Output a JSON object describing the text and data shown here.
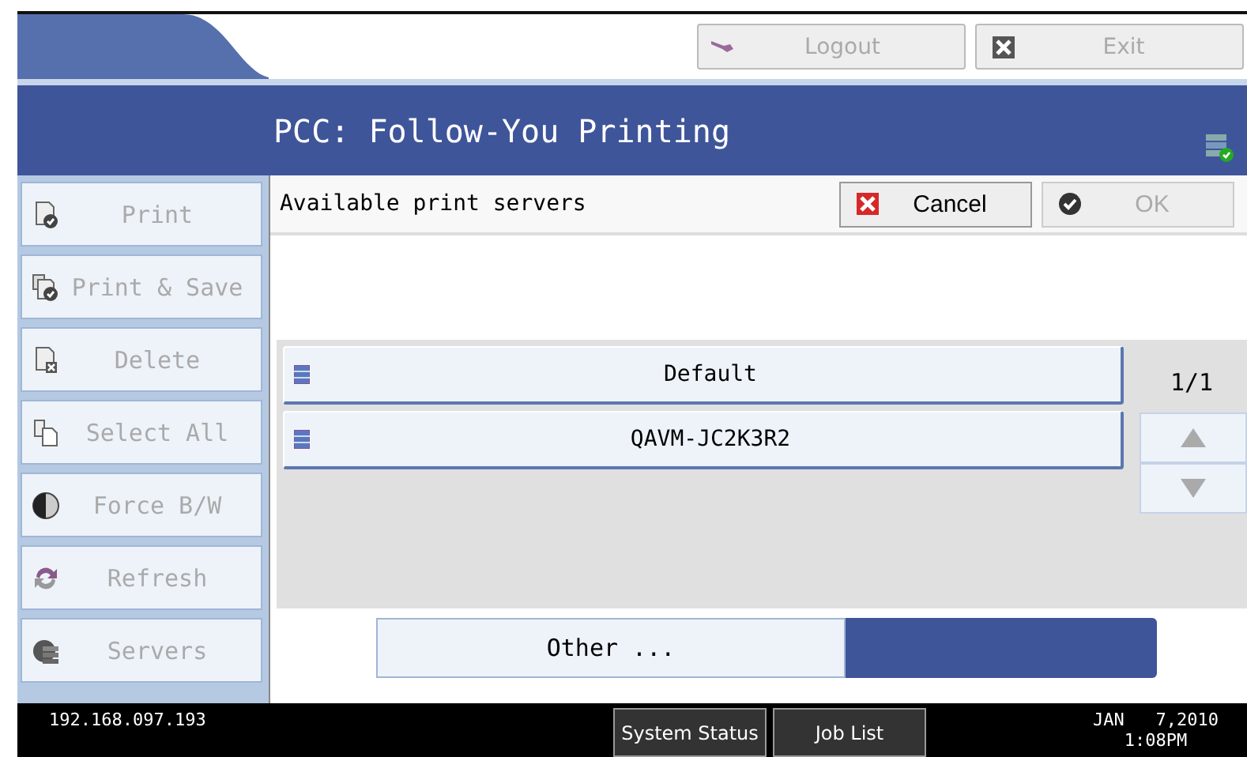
{
  "top_buttons": [
    {
      "kind": "logout",
      "label": "Logout",
      "disabled": true
    },
    {
      "kind": "exit",
      "label": "Exit",
      "disabled": true
    }
  ],
  "window": {
    "title": "PCC: Follow-You Printing"
  },
  "sidebar": {
    "items": [
      {
        "kind": "print",
        "label": "Print",
        "disabled": true
      },
      {
        "kind": "print-save",
        "label": "Print & Save",
        "disabled": true
      },
      {
        "kind": "delete",
        "label": "Delete",
        "disabled": true
      },
      {
        "kind": "select-all",
        "label": "Select All",
        "disabled": true
      },
      {
        "kind": "force-bw",
        "label": "Force B/W",
        "disabled": true
      },
      {
        "kind": "refresh",
        "label": "Refresh",
        "disabled": true
      },
      {
        "kind": "servers",
        "label": "Servers",
        "disabled": true
      }
    ]
  },
  "header": {
    "label": "Available print servers",
    "buttons": [
      {
        "kind": "cancel",
        "label": "Cancel",
        "disabled": false
      },
      {
        "kind": "ok",
        "label": "OK",
        "disabled": true
      }
    ]
  },
  "servers": {
    "items": [
      {
        "label": "Default",
        "selected": false
      },
      {
        "label": "QAVM-JC2K3R2",
        "selected": false
      }
    ],
    "page": "1/1",
    "up_disabled": true,
    "down_disabled": true
  },
  "other_button": {
    "label": "Other ..."
  },
  "status_bar": {
    "ip": "192.168.097.193",
    "buttons": [
      "System Status",
      "Job List"
    ],
    "date": "JAN   7,2010",
    "time": "1:08PM"
  }
}
